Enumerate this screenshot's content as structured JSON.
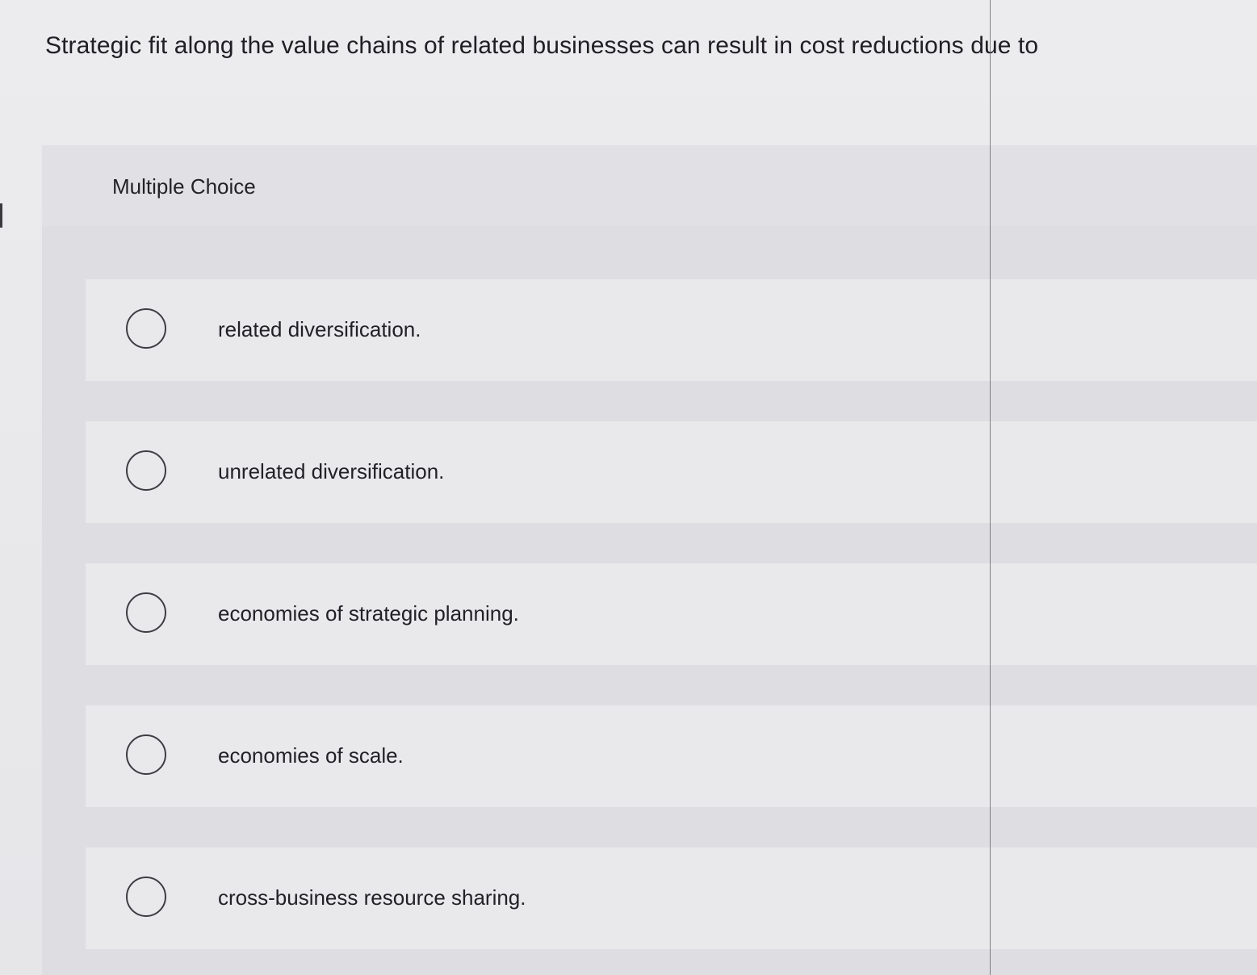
{
  "question": {
    "text": "Strategic fit along the value chains of related businesses can result in cost reductions due to"
  },
  "panel": {
    "title": "Multiple Choice"
  },
  "options": [
    {
      "label": "related diversification."
    },
    {
      "label": "unrelated diversification."
    },
    {
      "label": "economies of strategic planning."
    },
    {
      "label": "economies of scale."
    },
    {
      "label": "cross-business resource sharing."
    }
  ]
}
